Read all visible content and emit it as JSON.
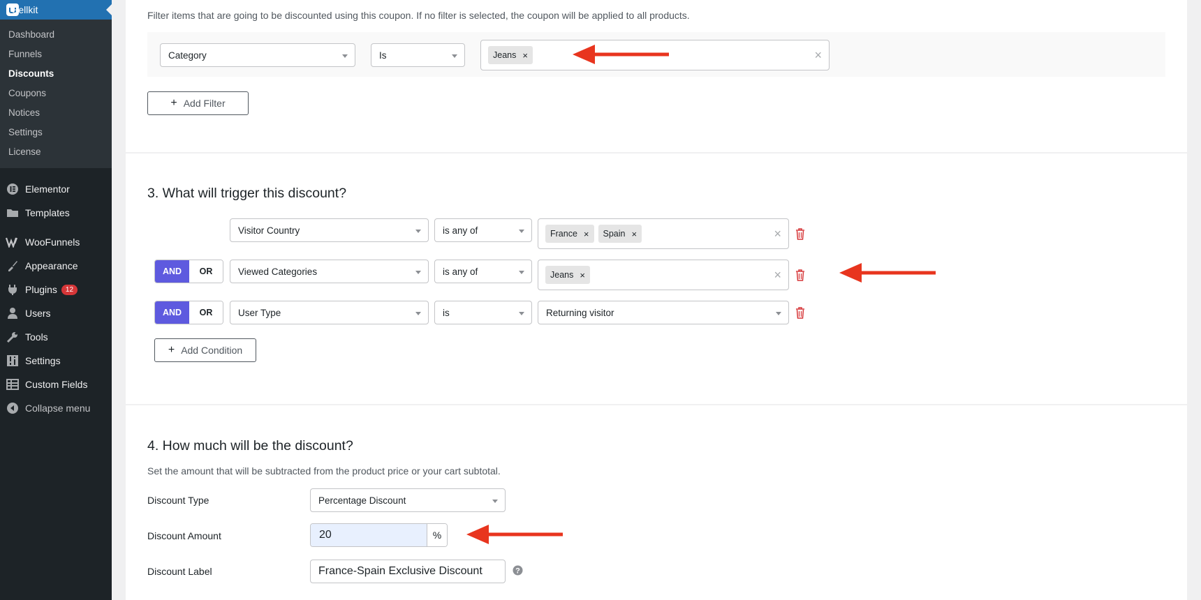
{
  "sidebar": {
    "app_title": "Sellkit",
    "submenu": [
      "Dashboard",
      "Funnels",
      "Discounts",
      "Coupons",
      "Notices",
      "Settings",
      "License"
    ],
    "current": "Discounts",
    "menu": {
      "elementor": "Elementor",
      "templates": "Templates",
      "woofunnels": "WooFunnels",
      "appearance": "Appearance",
      "plugins": "Plugins",
      "plugins_badge": "12",
      "users": "Users",
      "tools": "Tools",
      "settings": "Settings",
      "custom_fields": "Custom Fields",
      "collapse": "Collapse menu"
    }
  },
  "filter_section": {
    "description": "Filter items that are going to be discounted using this coupon. If no filter is selected, the coupon will be applied to all products.",
    "field": "Category",
    "operator": "Is",
    "tags": [
      "Jeans"
    ],
    "add_filter": "Add Filter"
  },
  "trigger_section": {
    "title": "3. What will trigger this discount?",
    "and_label": "AND",
    "or_label": "OR",
    "rows": [
      {
        "field": "Visitor Country",
        "operator": "is any of",
        "tags": [
          "France",
          "Spain"
        ]
      },
      {
        "field": "Viewed Categories",
        "operator": "is any of",
        "tags": [
          "Jeans"
        ]
      },
      {
        "field": "User Type",
        "operator": "is",
        "value": "Returning visitor"
      }
    ],
    "add_condition": "Add Condition"
  },
  "amount_section": {
    "title": "4. How much will be the discount?",
    "description": "Set the amount that will be subtracted from the product price or your cart subtotal.",
    "type_label": "Discount Type",
    "type_value": "Percentage Discount",
    "amount_label": "Discount Amount",
    "amount_value": "20",
    "amount_unit": "%",
    "label_label": "Discount Label",
    "label_value": "France-Spain Exclusive Discount"
  },
  "colors": {
    "accent": "#5e5adf",
    "arrow": "#e8351e",
    "admin_bar": "#1d2327",
    "active_blue": "#2271b1"
  }
}
